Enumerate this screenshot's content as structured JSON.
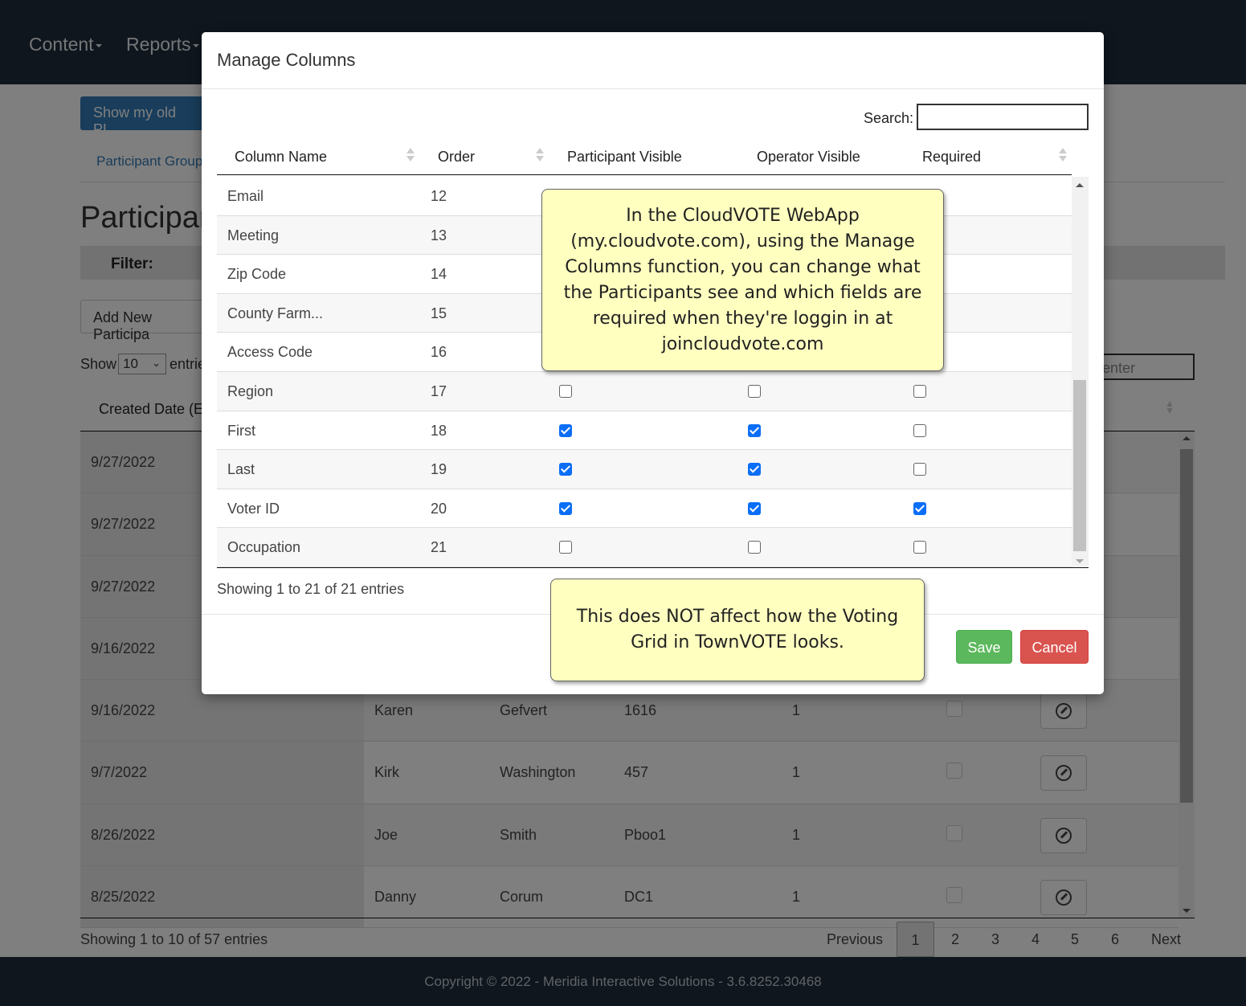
{
  "nav": {
    "content": "Content",
    "reports": "Reports"
  },
  "page": {
    "show_old_pl_button": "Show my old PL",
    "breadcrumb": "Participant Group",
    "title": "Participar",
    "filter_label": "Filter:",
    "add_button": "Add New Participa",
    "show_label": "Show",
    "page_size": "10",
    "entries_label": "entrie",
    "search_partial": "enter",
    "table_header_first": "Created Date (ET",
    "rows": [
      {
        "date": "9/27/2022",
        "first": "",
        "last": "",
        "id": "",
        "num": ""
      },
      {
        "date": "9/27/2022",
        "first": "",
        "last": "",
        "id": "",
        "num": ""
      },
      {
        "date": "9/27/2022",
        "first": "",
        "last": "",
        "id": "",
        "num": ""
      },
      {
        "date": "9/16/2022",
        "first": "",
        "last": "",
        "id": "",
        "num": ""
      },
      {
        "date": "9/16/2022",
        "first": "Karen",
        "last": "Gefvert",
        "id": "1616",
        "num": "1"
      },
      {
        "date": "9/7/2022",
        "first": "Kirk",
        "last": "Washington",
        "id": "457",
        "num": "1"
      },
      {
        "date": "8/26/2022",
        "first": "Joe",
        "last": "Smith",
        "id": "Pboo1",
        "num": "1"
      },
      {
        "date": "8/25/2022",
        "first": "Danny",
        "last": "Corum",
        "id": "DC1",
        "num": "1"
      }
    ],
    "showing_text": "Showing 1 to 10 of 57 entries",
    "pagination": {
      "previous": "Previous",
      "pages": [
        "1",
        "2",
        "3",
        "4",
        "5",
        "6"
      ],
      "next": "Next",
      "current": "1"
    }
  },
  "footer": {
    "copyright": "Copyright © 2022 - Meridia Interactive Solutions - 3.6.8252.30468"
  },
  "modal": {
    "title": "Manage Columns",
    "search_label": "Search:",
    "search_value": "",
    "columns": {
      "name": "Column Name",
      "order": "Order",
      "participant_visible": "Participant Visible",
      "operator_visible": "Operator Visible",
      "required": "Required"
    },
    "rows": [
      {
        "name": "Email",
        "order": "12",
        "pv": null,
        "ov": null,
        "req": null
      },
      {
        "name": "Meeting",
        "order": "13",
        "pv": null,
        "ov": null,
        "req": null
      },
      {
        "name": "Zip Code",
        "order": "14",
        "pv": null,
        "ov": null,
        "req": null
      },
      {
        "name": "County Farm...",
        "order": "15",
        "pv": null,
        "ov": null,
        "req": null
      },
      {
        "name": "Access Code",
        "order": "16",
        "pv": null,
        "ov": null,
        "req": null
      },
      {
        "name": "Region",
        "order": "17",
        "pv": false,
        "ov": false,
        "req": false
      },
      {
        "name": "First",
        "order": "18",
        "pv": true,
        "ov": true,
        "req": false
      },
      {
        "name": "Last",
        "order": "19",
        "pv": true,
        "ov": true,
        "req": false
      },
      {
        "name": "Voter ID",
        "order": "20",
        "pv": true,
        "ov": true,
        "req": true
      },
      {
        "name": "Occupation",
        "order": "21",
        "pv": false,
        "ov": false,
        "req": false
      }
    ],
    "showing_text": "Showing 1 to 21 of 21 entries",
    "save_label": "Save",
    "cancel_label": "Cancel"
  },
  "callouts": {
    "first": "In the CloudVOTE WebApp (my.cloudvote.com), using the Manage Columns function, you can change what the Participants see and which fields are required when they're loggin in at joincloudvote.com",
    "second": "This does NOT affect how the Voting Grid in TownVOTE looks."
  },
  "colors": {
    "navbar": "#1f2d3d",
    "primary": "#337ab7",
    "save": "#5cb85c",
    "cancel": "#d9534f",
    "checkbox_checked": "#0b6ef6",
    "callout_bg": "#ffffc0"
  }
}
